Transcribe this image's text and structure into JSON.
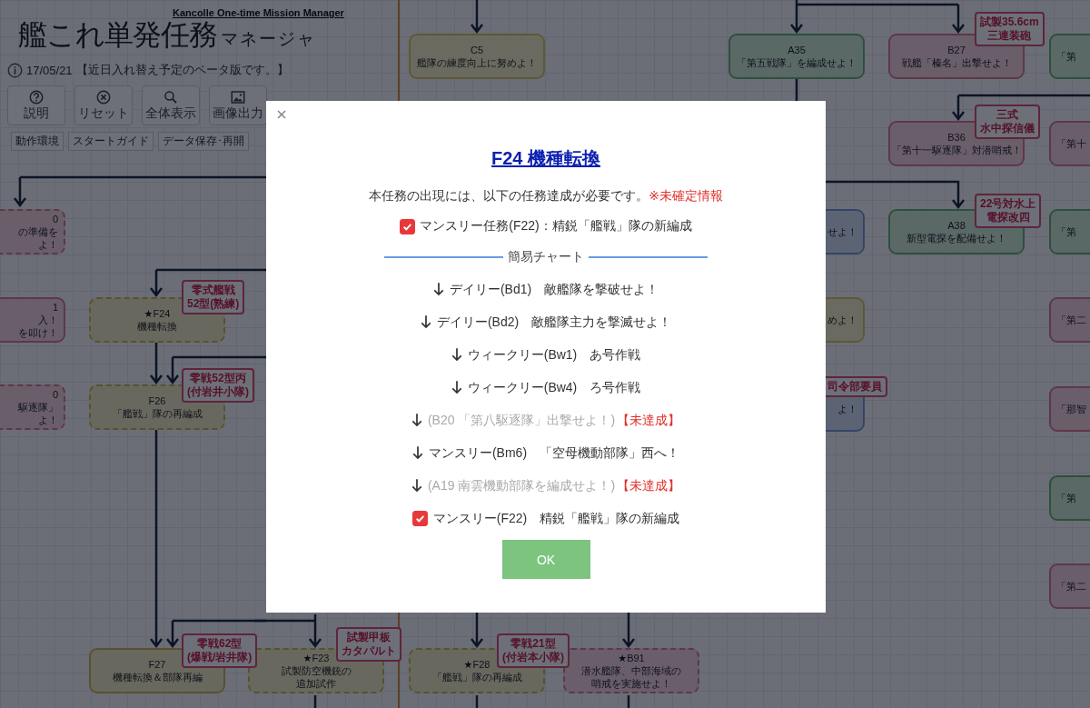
{
  "header": {
    "title": "艦これ単発任務",
    "title_suffix": "マネージャ",
    "subtitle": "Kancolle One-time Mission Manager",
    "version_date": "17/05/21",
    "version_note": "【近日入れ替え予定のベータ版です。】",
    "toolbar": [
      {
        "label": "説明",
        "kind": "help"
      },
      {
        "label": "リセット",
        "kind": "reset"
      },
      {
        "label": "全体表示",
        "kind": "zoom"
      },
      {
        "label": "画像出力",
        "kind": "image"
      }
    ],
    "links": [
      "動作環境",
      "スタートガイド",
      "データ保存･再開"
    ]
  },
  "flowchart": {
    "nodes": [
      {
        "code": "C5",
        "lines": [
          "艦隊の練度向上に努めよ！"
        ],
        "kind": "exercise",
        "dashed": false
      },
      {
        "code": "A35",
        "lines": [
          "「第五戦隊」を編成せよ！"
        ],
        "kind": "composition",
        "dashed": false
      },
      {
        "code": "B27",
        "lines": [
          "戦艦「榛名」出撃せよ！"
        ],
        "kind": "sortie",
        "dashed": false,
        "tag": [
          "試製35.6cm",
          "三連装砲"
        ]
      },
      {
        "lines": [
          "「第"
        ],
        "kind": "composition",
        "dashed": false
      },
      {
        "code": "B36",
        "lines": [
          "「第十一駆逐隊」対潜哨戒！"
        ],
        "kind": "sortie",
        "dashed": false,
        "tag": [
          "三式",
          "水中探信儀"
        ]
      },
      {
        "lines": [
          "「第十"
        ],
        "kind": "sortie",
        "dashed": false
      },
      {
        "code": "A38",
        "lines": [
          "新型電探を配備せよ！"
        ],
        "kind": "composition",
        "dashed": false,
        "tag": [
          "22号対水上",
          "電探改四"
        ]
      },
      {
        "lines": [
          "せよ！"
        ],
        "kind": "expedition",
        "dashed": false
      },
      {
        "lines": [
          "「第"
        ],
        "kind": "composition",
        "dashed": false
      },
      {
        "lines": [
          "めよ！"
        ],
        "kind": "exercise",
        "dashed": false
      },
      {
        "lines": [
          "「第二"
        ],
        "kind": "sortie",
        "dashed": false
      },
      {
        "lines": [
          "よ！"
        ],
        "kind": "expedition",
        "dashed": false,
        "tag": [
          "司令部要員"
        ]
      },
      {
        "lines": [
          "「那智"
        ],
        "kind": "sortie",
        "dashed": false
      },
      {
        "lines": [
          "「第"
        ],
        "kind": "composition",
        "dashed": false
      },
      {
        "lines": [
          "「第二"
        ],
        "kind": "sortie",
        "dashed": false
      },
      {
        "code": "0",
        "lines": [
          "の準備を",
          "よ！"
        ],
        "kind": "sortie",
        "dashed": true
      },
      {
        "code": "1",
        "lines": [
          "入！",
          "を叩け！"
        ],
        "kind": "sortie",
        "dashed": false
      },
      {
        "code": "0",
        "lines": [
          "駆逐隊」",
          "よ！"
        ],
        "kind": "sortie",
        "dashed": true
      },
      {
        "code": "★F24",
        "lines": [
          "機種転換"
        ],
        "kind": "factory",
        "dashed": true,
        "tag": [
          "零式艦戦",
          "52型(熟練)"
        ]
      },
      {
        "code": "F26",
        "lines": [
          "「艦戦」隊の再編成"
        ],
        "kind": "factory",
        "dashed": true,
        "tag": [
          "零戦52型丙",
          "(付岩井小隊)"
        ]
      },
      {
        "code": "F27",
        "lines": [
          "機種転換＆部隊再編"
        ],
        "kind": "factory",
        "dashed": false,
        "tag": [
          "零戦62型",
          "(爆戦/岩井隊)"
        ]
      },
      {
        "code": "★F23",
        "lines": [
          "試製防空機銃の",
          "追加試作"
        ],
        "kind": "factory",
        "dashed": true,
        "tag": [
          "試製甲板",
          "カタパルト"
        ]
      },
      {
        "code": "★F28",
        "lines": [
          "「艦戦」隊の再編成"
        ],
        "kind": "factory",
        "dashed": true,
        "tag": [
          "零戦21型",
          "(付岩本小隊)"
        ]
      },
      {
        "code": "★B91",
        "lines": [
          "潜水艦隊、中部海域の",
          "哨戒を実施せよ！"
        ],
        "kind": "sortie",
        "dashed": true
      }
    ]
  },
  "dialog": {
    "title": "F24 機種転換",
    "intro": "本任務の出現には、以下の任務達成が必要です。",
    "intro_note": "※未確定情報",
    "requirement": {
      "text": "マンスリー任務(F22)：精鋭「艦戦」隊の新編成",
      "checked": true
    },
    "chart_heading": "簡易チャート",
    "chart_steps": [
      {
        "kind": "arrow",
        "text": "デイリー(Bd1)　敵艦隊を撃破せよ！",
        "done": true
      },
      {
        "kind": "arrow",
        "text": "デイリー(Bd2)　敵艦隊主力を撃滅せよ！",
        "done": true
      },
      {
        "kind": "arrow",
        "text": "ウィークリー(Bw1)　あ号作戦",
        "done": true
      },
      {
        "kind": "arrow",
        "text": "ウィークリー(Bw4)　ろ号作戦",
        "done": true
      },
      {
        "kind": "arrow",
        "text": "(B20 「第八駆逐隊」出撃せよ！)",
        "done": false,
        "note": "【未達成】"
      },
      {
        "kind": "arrow",
        "text": "マンスリー(Bm6)　「空母機動部隊」西へ！",
        "done": true
      },
      {
        "kind": "arrow",
        "text": "(A19 南雲機動部隊を編成せよ！)",
        "done": false,
        "note": "【未達成】"
      },
      {
        "kind": "check",
        "text": "マンスリー(F22)　精鋭「艦戦」隊の新編成",
        "done": true,
        "checked": true
      }
    ],
    "ok_button": "OK"
  }
}
